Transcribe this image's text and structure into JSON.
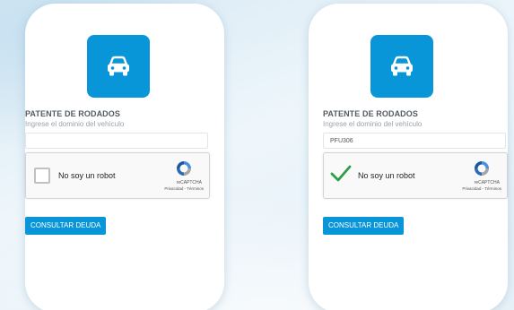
{
  "forms": [
    {
      "title": "PATENTE DE RODADOS",
      "subtitle": "Ingrese el dominio del vehículo",
      "input_value": "",
      "captcha": {
        "label": "No soy un robot",
        "checked": false,
        "brand": "reCAPTCHA",
        "links": "Privacidad - Términos"
      },
      "button_label": "CONSULTAR DEUDA"
    },
    {
      "title": "PATENTE DE RODADOS",
      "subtitle": "Ingrese el dominio del vehículo",
      "input_value": "PFU306",
      "captcha": {
        "label": "No soy un robot",
        "checked": true,
        "brand": "reCAPTCHA",
        "links": "Privacidad - Términos"
      },
      "button_label": "CONSULTAR DEUDA"
    }
  ],
  "icons": {
    "tile": "car-icon",
    "captcha": "recaptcha-logo-icon",
    "checkmark": "checkmark-icon"
  },
  "colors": {
    "accent": "#0896d9",
    "check_green": "#2e9e46"
  }
}
